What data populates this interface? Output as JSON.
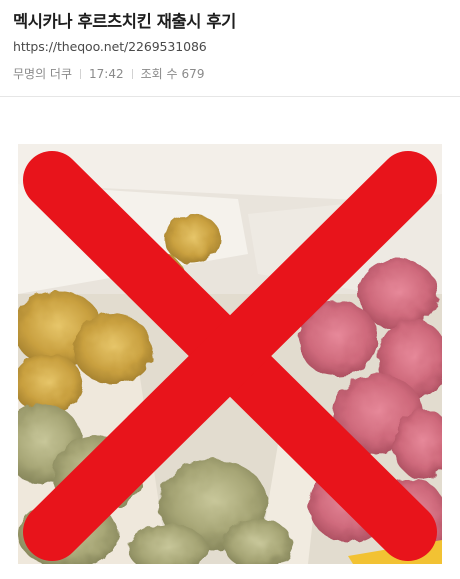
{
  "post": {
    "title": "멕시카나 후르츠치킨 재출시 후기",
    "url": "https://theqoo.net/2269531086",
    "author": "무명의 더쿠",
    "time": "17:42",
    "views_label": "조회 수",
    "views": "679"
  },
  "image": {
    "subject": "fried chicken in takeout boxes",
    "overlay": "red-x-mark",
    "overlay_color": "#e8141b"
  }
}
